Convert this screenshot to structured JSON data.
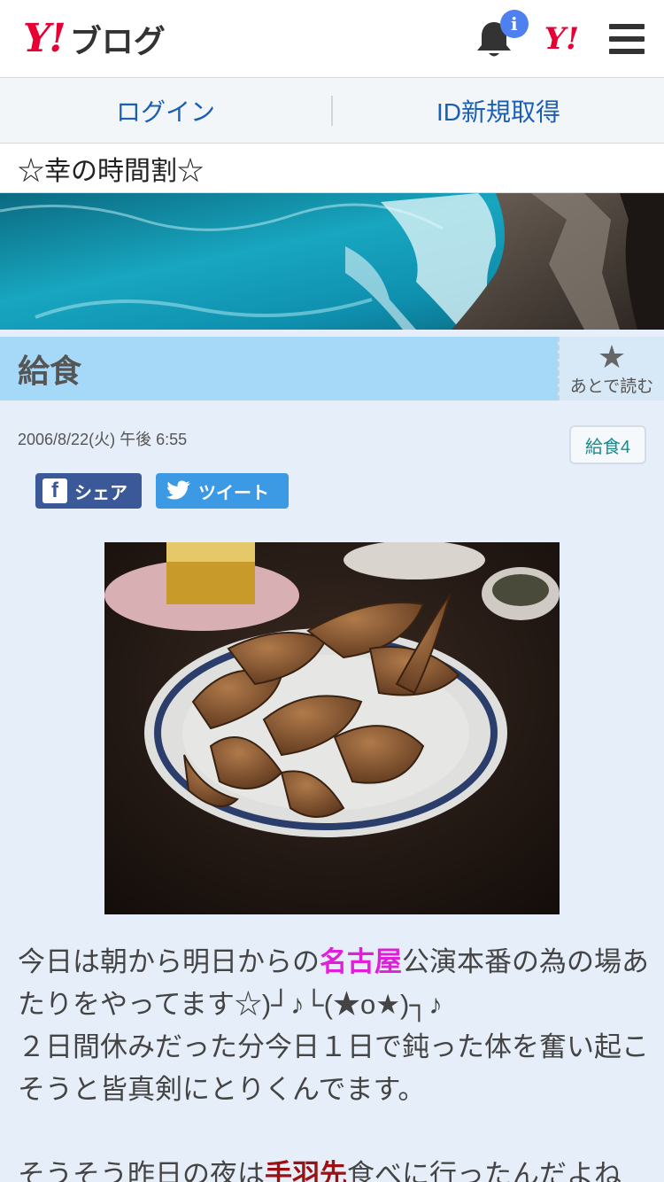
{
  "header": {
    "logo_y": "Y!",
    "logo_text": "ブログ",
    "notification_badge": "i",
    "yahoo_mark": "Y!"
  },
  "loginbar": {
    "login_label": "ログイン",
    "register_label": "ID新規取得"
  },
  "blog": {
    "title": "☆幸の時間割☆"
  },
  "article": {
    "title": "給食",
    "read_later_label": "あとで読む",
    "date": "2006/8/22(火) 午後 6:55",
    "category": "給食4",
    "share_fb_label": "シェア",
    "share_tw_label": "ツイート",
    "body": {
      "p1_a": "今日は朝から明日からの",
      "p1_highlight": "名古屋",
      "p1_b": "公演本番の為の場あたりをやってます☆)┘♪└(★o★)┐♪",
      "p2": "２日間休みだった分今日１日で鈍った体を奮い起こそうと皆真剣にとりくんでます。",
      "p3_a": "そうそう昨日の夜は",
      "p3_highlight": "手羽先",
      "p3_b": "食べに行ったんだよね"
    }
  },
  "colors": {
    "accent_red": "#e60033",
    "link_blue": "#1a5fb4",
    "title_bar": "#a6d8f8",
    "page_bg": "#e6eef9",
    "facebook": "#3b5998",
    "twitter": "#3c99e4"
  },
  "icons": {
    "bell": "bell-icon",
    "menu": "hamburger-menu-icon",
    "star": "star-icon",
    "facebook": "facebook-icon",
    "twitter": "twitter-bird-icon"
  }
}
